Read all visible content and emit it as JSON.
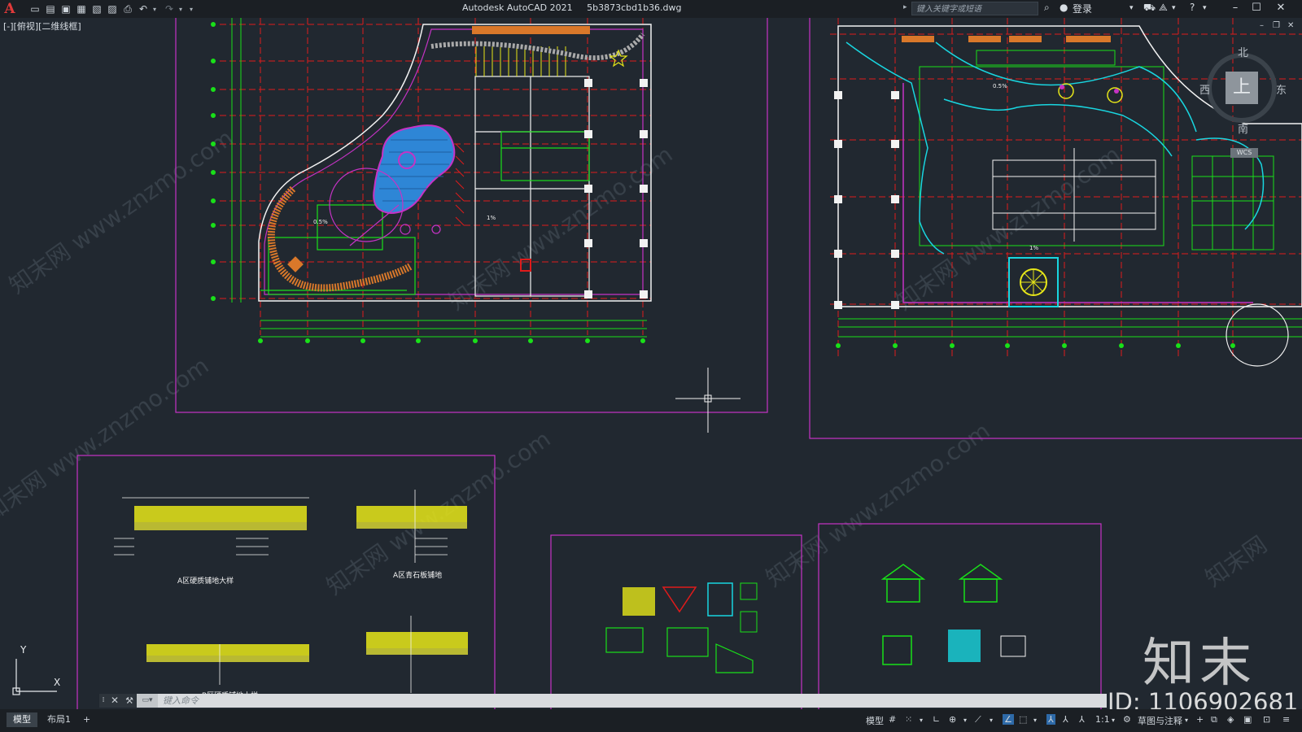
{
  "app": {
    "title": "Autodesk AutoCAD 2021",
    "filename": "5b3873cbd1b36.dwg",
    "logo": "A"
  },
  "search": {
    "placeholder": "键入关键字或短语"
  },
  "user": {
    "login_label": "登录"
  },
  "viewport": {
    "label": "[-][俯视][二维线框]"
  },
  "viewcube": {
    "top": "上",
    "north": "北",
    "south": "南",
    "east": "东",
    "west": "西",
    "wcs": "WCS"
  },
  "ucs": {
    "x": "X",
    "y": "Y"
  },
  "command": {
    "placeholder": "键入命令"
  },
  "tabs": {
    "model": "模型",
    "layout1": "布局1",
    "add": "+"
  },
  "status": {
    "model": "模型",
    "scale": "1:1",
    "workspace": "草图与注释"
  },
  "watermark": {
    "brand": "知末",
    "id": "ID: 1106902681",
    "site": "www.znzmo.com",
    "cn": "知末网"
  },
  "drawings": {
    "detail_a1": "A区硬质铺地大样",
    "detail_a2": "A区青石板铺地",
    "detail_b1": "B区硬质铺地大样",
    "slope": "0.5%",
    "slope2": "1%"
  },
  "colors": {
    "background": "#212830",
    "magenta": "#c533c5",
    "green": "#19e019",
    "red": "#e01b1b",
    "cyan": "#19d6e0",
    "white": "#f2f2f2",
    "yellow": "#e6e619",
    "orange": "#d9782a",
    "blue": "#2e86d6"
  }
}
